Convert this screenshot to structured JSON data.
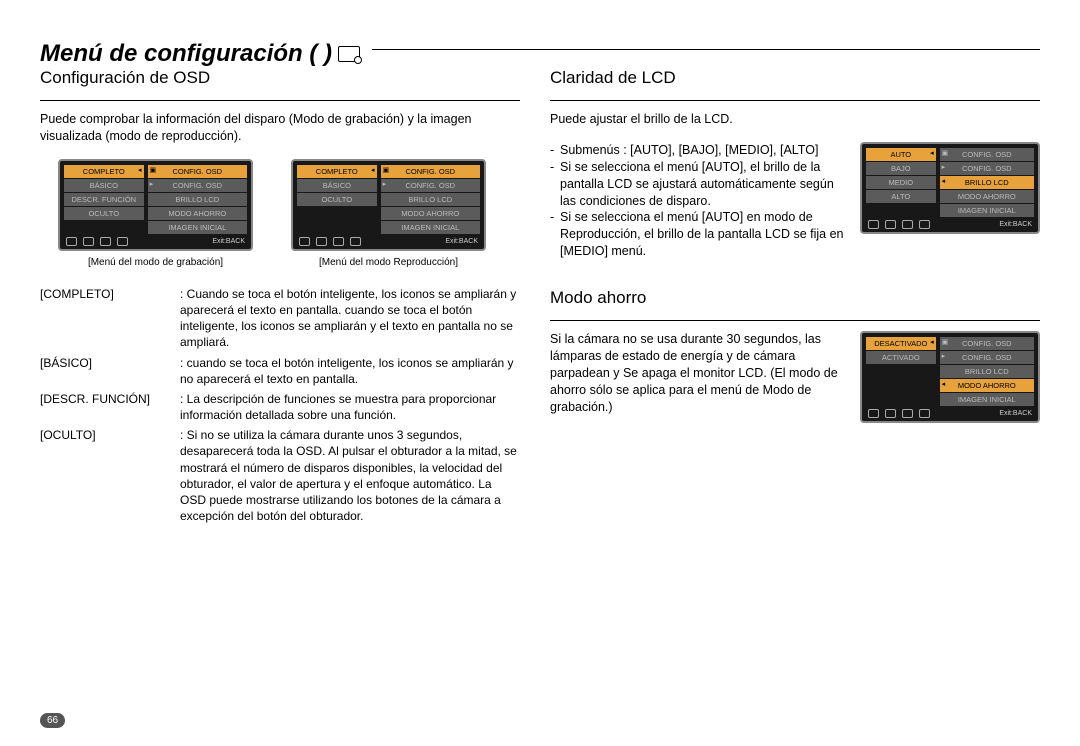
{
  "page_number": "66",
  "main_title": "Menú de configuración (      )",
  "left": {
    "heading": "Configuración de OSD",
    "intro": "Puede comprobar la información del disparo (Modo de grabación) y la imagen visualizada (modo de reproducción).",
    "menu1": {
      "caption": "[Menú del modo de grabación]",
      "left": [
        "COMPLETO",
        "BÁSICO",
        "DESCR. FUNCIÓN",
        "OCULTO"
      ],
      "right": [
        "CONFIG. OSD",
        "CONFIG. OSD",
        "BRILLO LCD",
        "MODO AHORRO",
        "IMAGEN INICIAL"
      ],
      "exit": "Exit:BACK",
      "left_hl_index": 0,
      "right_hl_index": 0
    },
    "menu2": {
      "caption": "[Menú del modo Reproducción]",
      "left": [
        "COMPLETO",
        "BÁSICO",
        "OCULTO"
      ],
      "right": [
        "CONFIG. OSD",
        "CONFIG. OSD",
        "BRILLO LCD",
        "MODO AHORRO",
        "IMAGEN INICIAL"
      ],
      "exit": "Exit:BACK",
      "left_hl_index": 0,
      "right_hl_index": 0
    },
    "desc": {
      "term0": "[COMPLETO]",
      "body0": ": Cuando se toca el botón inteligente, los iconos se ampliarán y aparecerá el texto en pantalla. cuando se toca el botón inteligente, los iconos se ampliarán y el texto en pantalla no se ampliará.",
      "term1": "[BÁSICO]",
      "body1": ": cuando se toca el botón inteligente, los iconos se ampliarán y no aparecerá el texto en pantalla.",
      "term2": "[DESCR. FUNCIÓN]",
      "body2": ": La descripción de funciones se muestra para proporcionar información detallada sobre una función.",
      "term3": "[OCULTO]",
      "body3": ": Si no se utiliza la cámara durante unos 3 segundos, desaparecerá toda la OSD. Al pulsar el obturador a la mitad, se mostrará el número de disparos disponibles, la velocidad del obturador, el valor de apertura y el enfoque automático. La OSD puede mostrarse utilizando los botones de la cámara a excepción del botón del obturador."
    }
  },
  "right": {
    "sec1": {
      "heading": "Claridad de LCD",
      "intro": "Puede ajustar el brillo de la LCD.",
      "b0": "Submenús : [AUTO], [BAJO], [MEDIO], [ALTO]",
      "b1": "Si se selecciona el menú [AUTO], el brillo de la pantalla LCD se ajustará automáticamente según las condiciones de disparo.",
      "b2": "Si se selecciona el menú [AUTO] en modo de Reproducción, el brillo de la pantalla LCD se fija en [MEDIO] menú.",
      "menu": {
        "left": [
          "AUTO",
          "BAJO",
          "MEDIO",
          "ALTO"
        ],
        "right": [
          "CONFIG. OSD",
          "CONFIG. OSD",
          "BRILLO LCD",
          "MODO AHORRO",
          "IMAGEN INICIAL"
        ],
        "exit": "Exit:BACK",
        "left_hl_index": 0,
        "right_hl_index": 2
      }
    },
    "sec2": {
      "heading": "Modo ahorro",
      "body": "Si la cámara no se usa durante 30 segundos, las lámparas de estado de energía y de cámara parpadean y Se apaga el monitor LCD. (El modo de ahorro sólo se aplica para el menú de Modo de grabación.)",
      "menu": {
        "left": [
          "DESACTIVADO",
          "ACTIVADO"
        ],
        "right": [
          "CONFIG. OSD",
          "CONFIG. OSD",
          "BRILLO LCD",
          "MODO AHORRO",
          "IMAGEN INICIAL"
        ],
        "exit": "Exit:BACK",
        "left_hl_index": 0,
        "right_hl_index": 3
      }
    }
  }
}
